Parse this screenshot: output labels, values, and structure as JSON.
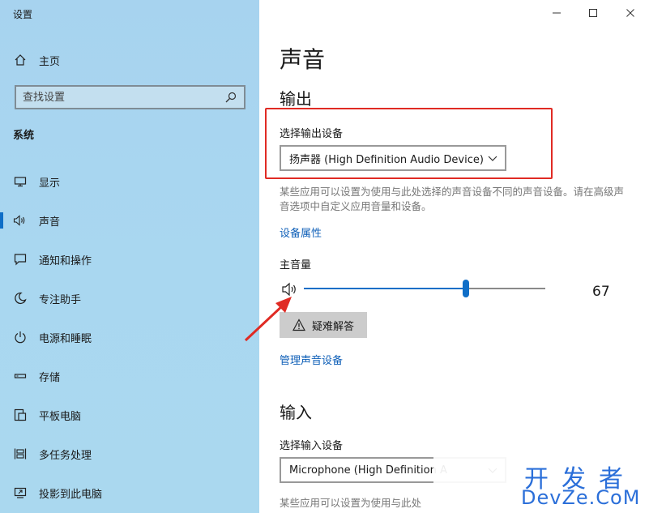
{
  "window": {
    "title": "设置",
    "minimize_label": "—",
    "maximize_label": "□",
    "close_label": "✕"
  },
  "sidebar": {
    "home_label": "主页",
    "search_placeholder": "查找设置",
    "section_title": "系统",
    "items": [
      {
        "label": "显示",
        "icon": "monitor-icon"
      },
      {
        "label": "声音",
        "icon": "speaker-icon",
        "active": true
      },
      {
        "label": "通知和操作",
        "icon": "notification-icon"
      },
      {
        "label": "专注助手",
        "icon": "moon-icon"
      },
      {
        "label": "电源和睡眠",
        "icon": "power-icon"
      },
      {
        "label": "存储",
        "icon": "storage-icon"
      },
      {
        "label": "平板电脑",
        "icon": "tablet-icon"
      },
      {
        "label": "多任务处理",
        "icon": "multitask-icon"
      },
      {
        "label": "投影到此电脑",
        "icon": "project-icon"
      }
    ]
  },
  "main": {
    "title": "声音",
    "output": {
      "heading": "输出",
      "device_label": "选择输出设备",
      "device_value": "扬声器 (High Definition Audio Device)",
      "description": "某些应用可以设置为使用与此处选择的声音设备不同的声音设备。请在高级声音选项中自定义应用音量和设备。",
      "properties_link": "设备属性",
      "volume_label": "主音量",
      "volume_value": "67",
      "volume_fraction": 0.67,
      "troubleshoot_label": "疑难解答",
      "manage_link": "管理声音设备"
    },
    "input": {
      "heading": "输入",
      "device_label": "选择输入设备",
      "device_value": "Microphone (High Definition A",
      "description": "某些应用可以设置为使用与此处"
    }
  },
  "watermark": {
    "top": "开发者",
    "bottom": "DevZe.CoM"
  },
  "colors": {
    "accent": "#0f6ec7",
    "link": "#1060b8",
    "annotation": "#e02b24",
    "watermark": "#2b6fd9"
  }
}
